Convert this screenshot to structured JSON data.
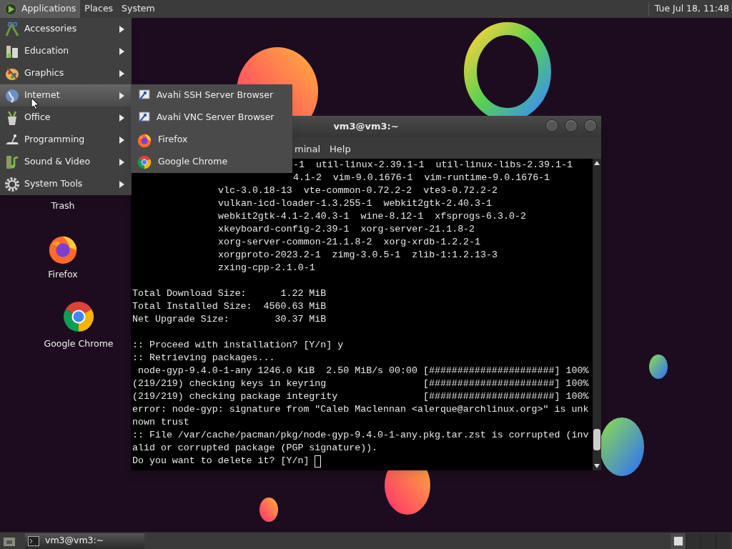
{
  "top_panel": {
    "menus": [
      {
        "label": "Applications",
        "selected": true
      },
      {
        "label": "Places",
        "selected": false
      },
      {
        "label": "System",
        "selected": false
      }
    ],
    "clock": "Tue Jul 18, 11:48"
  },
  "applications_menu": {
    "items": [
      {
        "label": "Accessories",
        "selected": false
      },
      {
        "label": "Education",
        "selected": false
      },
      {
        "label": "Graphics",
        "selected": false
      },
      {
        "label": "Internet",
        "selected": true
      },
      {
        "label": "Office",
        "selected": false
      },
      {
        "label": "Programming",
        "selected": false
      },
      {
        "label": "Sound & Video",
        "selected": false
      },
      {
        "label": "System Tools",
        "selected": false
      }
    ]
  },
  "internet_submenu": {
    "items": [
      {
        "label": "Avahi SSH Server Browser"
      },
      {
        "label": "Avahi VNC Server Browser"
      },
      {
        "label": "Firefox"
      },
      {
        "label": "Google Chrome"
      }
    ]
  },
  "desktop_icons": [
    {
      "label": "Trash"
    },
    {
      "label": "Firefox"
    },
    {
      "label": "Google Chrome"
    }
  ],
  "terminal": {
    "title": "vm3@vm3:~",
    "menus": [
      "minal",
      "Help"
    ],
    "lines": [
      {
        "kind": "cut",
        "text": "-1  util-linux-2.39.1-1  util-linux-libs-2.39.1-1"
      },
      {
        "kind": "cut",
        "text": "4.1-2  vim-9.0.1676-1  vim-runtime-9.0.1676-1"
      },
      {
        "kind": "package",
        "text": "vlc-3.0.18-13  vte-common-0.72.2-2  vte3-0.72.2-2"
      },
      {
        "kind": "package",
        "text": "vulkan-icd-loader-1.3.255-1  webkit2gtk-2.40.3-1"
      },
      {
        "kind": "package",
        "text": "webkit2gtk-4.1-2.40.3-1  wine-8.12-1  xfsprogs-6.3.0-2"
      },
      {
        "kind": "package",
        "text": "xkeyboard-config-2.39-1  xorg-server-21.1.8-2"
      },
      {
        "kind": "package",
        "text": "xorg-server-common-21.1.8-2  xorg-xrdb-1.2.2-1"
      },
      {
        "kind": "package",
        "text": "xorgproto-2023.2-1  zimg-3.0.5-1  zlib-1:1.2.13-3"
      },
      {
        "kind": "package",
        "text": "zxing-cpp-2.1.0-1"
      },
      {
        "kind": "blank"
      },
      {
        "kind": "text",
        "text": "Total Download Size:      1.22 MiB"
      },
      {
        "kind": "text",
        "text": "Total Installed Size:  4560.63 MiB"
      },
      {
        "kind": "text",
        "text": "Net Upgrade Size:        30.37 MiB"
      },
      {
        "kind": "blank"
      },
      {
        "kind": "text",
        "text": ":: Proceed with installation? [Y/n] y"
      },
      {
        "kind": "text",
        "text": ":: Retrieving packages..."
      },
      {
        "kind": "text",
        "text": " node-gyp-9.4.0-1-any 1246.0 KiB  2.50 MiB/s 00:00 [######################] 100%"
      },
      {
        "kind": "text",
        "text": "(219/219) checking keys in keyring                 [######################] 100%"
      },
      {
        "kind": "text",
        "text": "(219/219) checking package integrity               [######################] 100%"
      },
      {
        "kind": "text",
        "text": "error: node-gyp: signature from \"Caleb Maclennan <alerque@archlinux.org>\" is unk"
      },
      {
        "kind": "text",
        "text": "nown trust"
      },
      {
        "kind": "text",
        "text": ":: File /var/cache/pacman/pkg/node-gyp-9.4.0-1-any.pkg.tar.zst is corrupted (inv"
      },
      {
        "kind": "text",
        "text": "alid or corrupted package (PGP signature))."
      },
      {
        "kind": "prompt",
        "text": "Do you want to delete it? [Y/n] "
      }
    ]
  },
  "taskbar": {
    "tasks": [
      {
        "label": "vm3@vm3:~"
      }
    ]
  }
}
